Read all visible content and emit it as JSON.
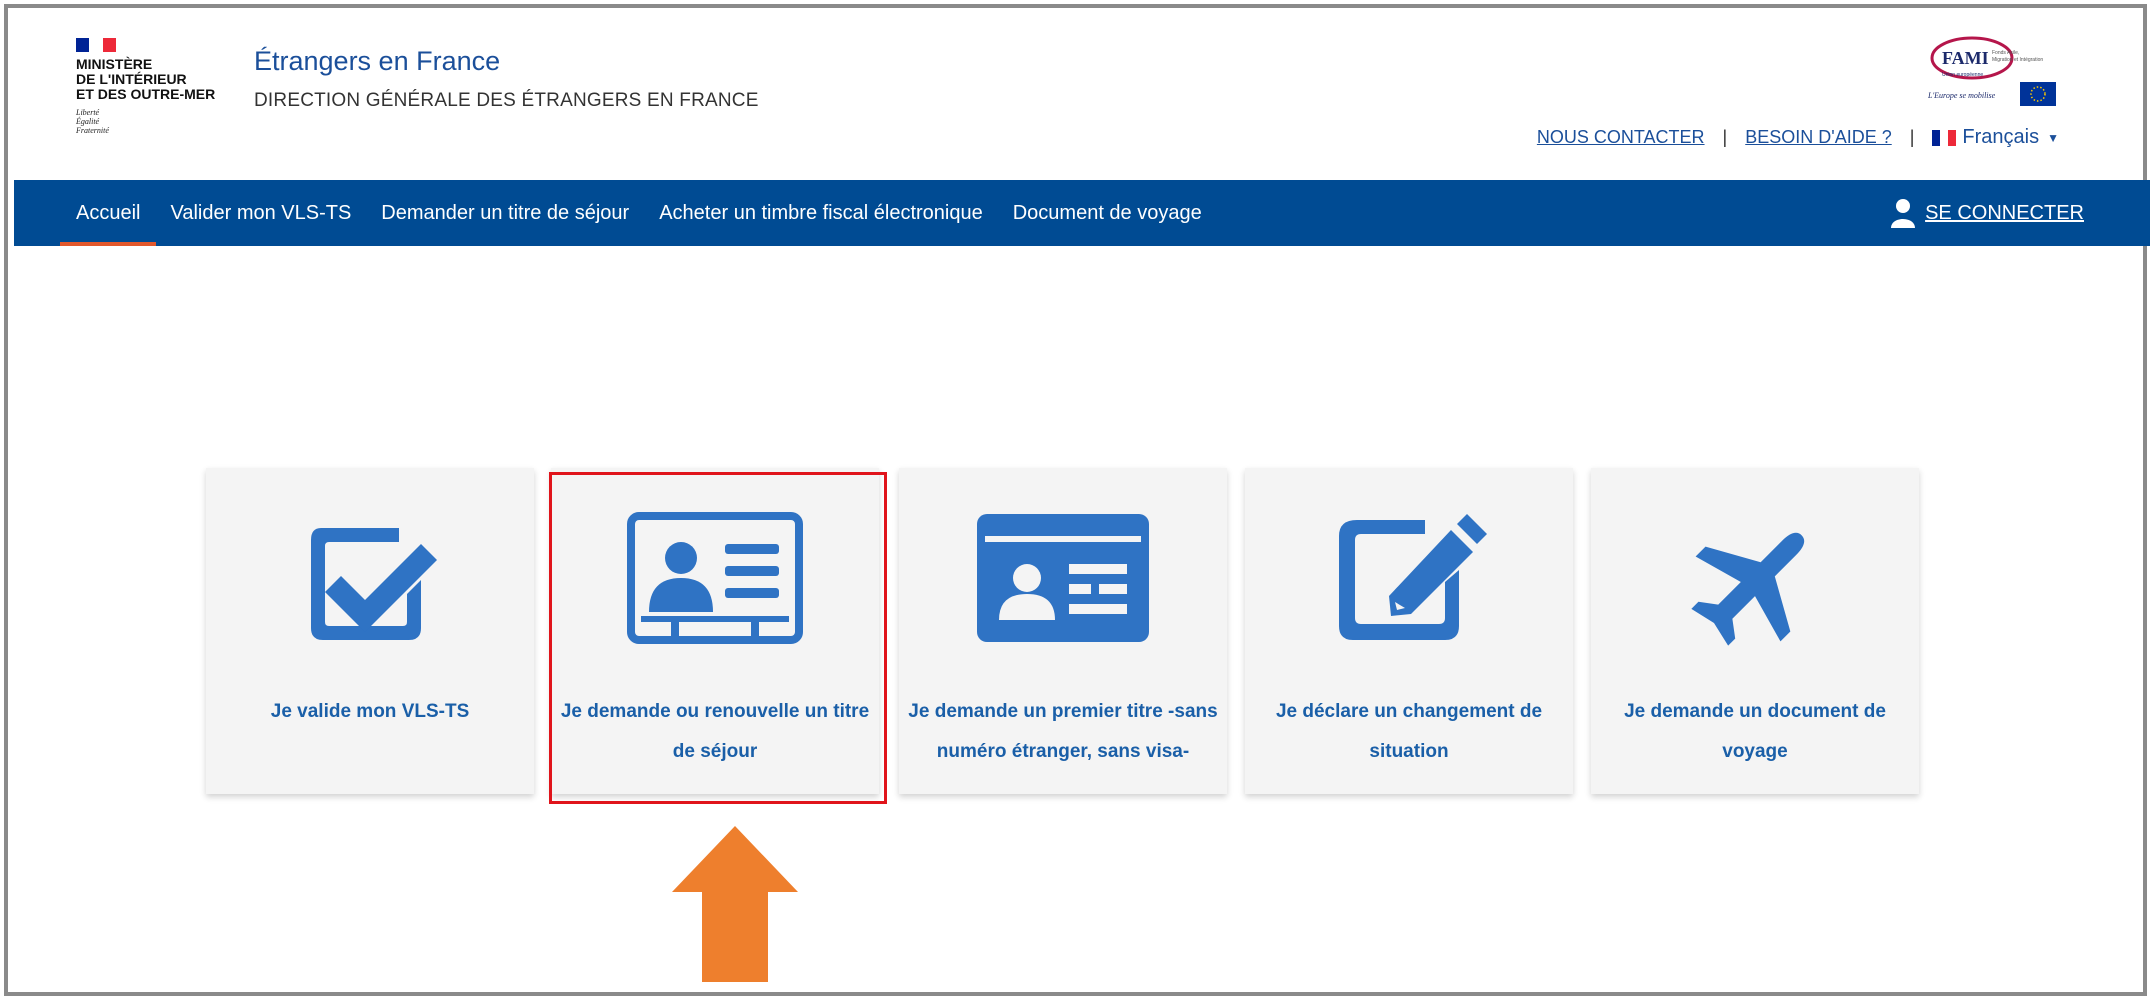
{
  "header": {
    "ministry_lines": [
      "MINISTÈRE",
      "DE L'INTÉRIEUR",
      "ET DES OUTRE-MER"
    ],
    "devise_lines": [
      "Liberté",
      "Égalité",
      "Fraternité"
    ],
    "site_title": "Étrangers en France",
    "site_subtitle": "DIRECTION GÉNÉRALE DES ÉTRANGERS EN FRANCE",
    "fami": {
      "brand": "FAMI",
      "tag1": "Fonds Asile, Migration et Intégration",
      "tag2": "Union européenne",
      "motto": "L'Europe se mobilise"
    },
    "links": {
      "contact": "NOUS CONTACTER",
      "help": "BESOIN D'AIDE ?",
      "separator": "|"
    },
    "language": "Français"
  },
  "nav": {
    "items": [
      {
        "label": "Accueil",
        "active": true
      },
      {
        "label": "Valider mon VLS-TS"
      },
      {
        "label": "Demander un titre de séjour"
      },
      {
        "label": "Acheter un timbre fiscal électronique"
      },
      {
        "label": "Document de voyage"
      }
    ],
    "connect": "SE CONNECTER"
  },
  "cards": [
    {
      "label": "Je valide mon VLS-TS",
      "icon": "checkbox-icon"
    },
    {
      "label": "Je demande ou renouvelle un titre de séjour",
      "icon": "id-badge-icon",
      "highlighted": true
    },
    {
      "label": "Je demande un premier titre -sans numéro étranger, sans visa-",
      "icon": "id-card-icon"
    },
    {
      "label": "Je déclare un changement de situation",
      "icon": "edit-icon"
    },
    {
      "label": "Je demande un document de voyage",
      "icon": "plane-icon"
    }
  ],
  "colors": {
    "primary": "#004b93",
    "link": "#1b4f9a",
    "card_text": "#1a5fa8",
    "icon": "#2f73c4",
    "active_underline": "#e2582c",
    "highlight_border": "#e0141b",
    "arrow": "#ee7f2d"
  }
}
